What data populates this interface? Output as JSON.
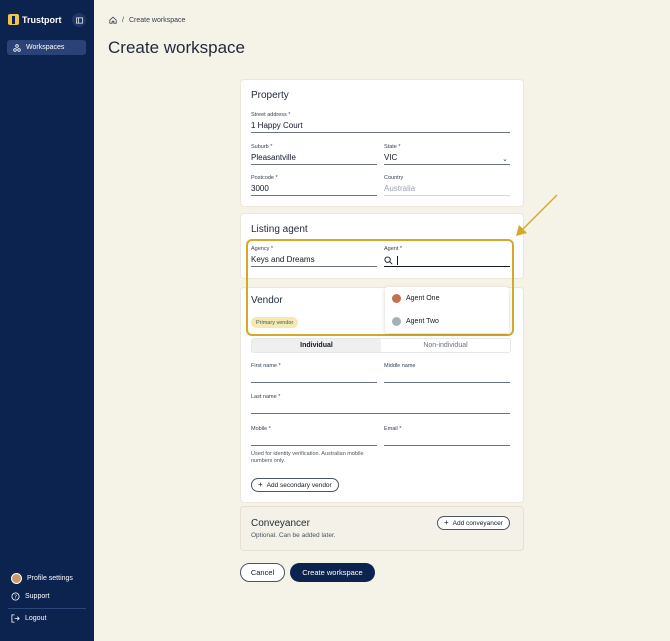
{
  "sidebar": {
    "logo_text": "Trustport",
    "nav_items": [
      {
        "label": "Workspaces",
        "icon": "workspaces-icon"
      }
    ],
    "bottom_items": [
      {
        "label": "Profile settings",
        "icon": "avatar"
      },
      {
        "label": "Support",
        "icon": "help-icon"
      },
      {
        "label": "Logout",
        "icon": "logout-icon"
      }
    ]
  },
  "breadcrumb": {
    "home_icon": "home-icon",
    "separator": "/",
    "current": "Create workspace"
  },
  "page_title": "Create workspace",
  "property": {
    "title": "Property",
    "street": {
      "label": "Street address *",
      "value": "1 Happy Court"
    },
    "suburb": {
      "label": "Suburb *",
      "value": "Pleasantville"
    },
    "state": {
      "label": "State *",
      "value": "VIC"
    },
    "postcode": {
      "label": "Postcode *",
      "value": "3000"
    },
    "country": {
      "label": "Country",
      "value": "Australia"
    }
  },
  "listing_agent": {
    "title": "Listing agent",
    "agency": {
      "label": "Agency *",
      "value": "Keys and Dreams"
    },
    "agent": {
      "label": "Agent *",
      "value": ""
    },
    "dropdown_options": [
      "Agent One",
      "Agent Two"
    ]
  },
  "vendor": {
    "title": "Vendor",
    "badge": "Primary vendor",
    "tabs": [
      "Individual",
      "Non-individual"
    ],
    "active_tab": "Individual",
    "first_name_label": "First name *",
    "middle_name_label": "Middle name",
    "last_name_label": "Last name *",
    "mobile_label": "Mobile *",
    "email_label": "Email *",
    "mobile_helper": "Used for identity verification. Australian mobile numbers only.",
    "add_secondary_label": "Add secondary vendor"
  },
  "conveyancer": {
    "title": "Conveyancer",
    "subtitle": "Optional. Can be added later.",
    "add_label": "Add conveyancer"
  },
  "actions": {
    "cancel": "Cancel",
    "submit": "Create workspace"
  },
  "colors": {
    "sidebar": "#0c2350",
    "highlight": "#d4a92a",
    "background": "#f5f2e8",
    "primary": "#0c2350"
  }
}
